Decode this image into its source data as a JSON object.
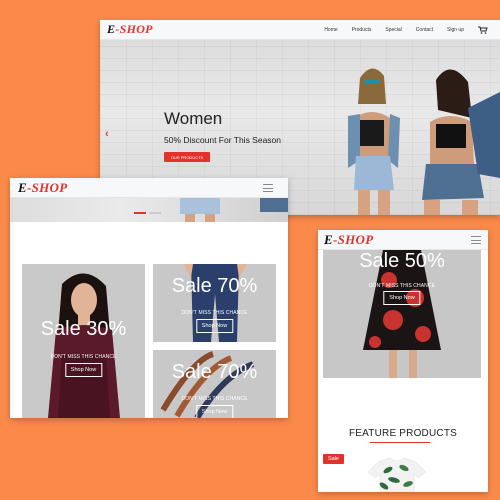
{
  "brand": {
    "e": "E",
    "rest": "-SHOP"
  },
  "desktop": {
    "nav": [
      "Home",
      "Products",
      "Special",
      "Contact",
      "Sign up"
    ],
    "hero_title": "Women",
    "hero_subtitle": "50% Discount For This Season",
    "hero_button": "OUR PRODUCTS"
  },
  "tablet": {
    "tiles": [
      {
        "sale": "Sale 30%",
        "chance": "DON'T MISS THIS CHANCE",
        "button": "Shop Now"
      },
      {
        "sale": "Sale 70%",
        "chance": "DON'T MISS THIS CHANCE",
        "button": "Shop Now"
      },
      {
        "sale": "Sale 70%",
        "chance": "DON'T MISS THIS CHANCE",
        "button": "Shop Now"
      }
    ]
  },
  "mobile": {
    "tile": {
      "sale": "Sale 50%",
      "chance": "DON'T MISS THIS CHANCE",
      "button": "Shop Now"
    },
    "feature_title": "FEATURE PRODUCTS",
    "badge": "Sale"
  },
  "colors": {
    "accent": "#e3322b",
    "background": "#fb8a4a"
  },
  "icons": [
    "cart-icon",
    "menu-icon",
    "chevron-left-icon"
  ]
}
